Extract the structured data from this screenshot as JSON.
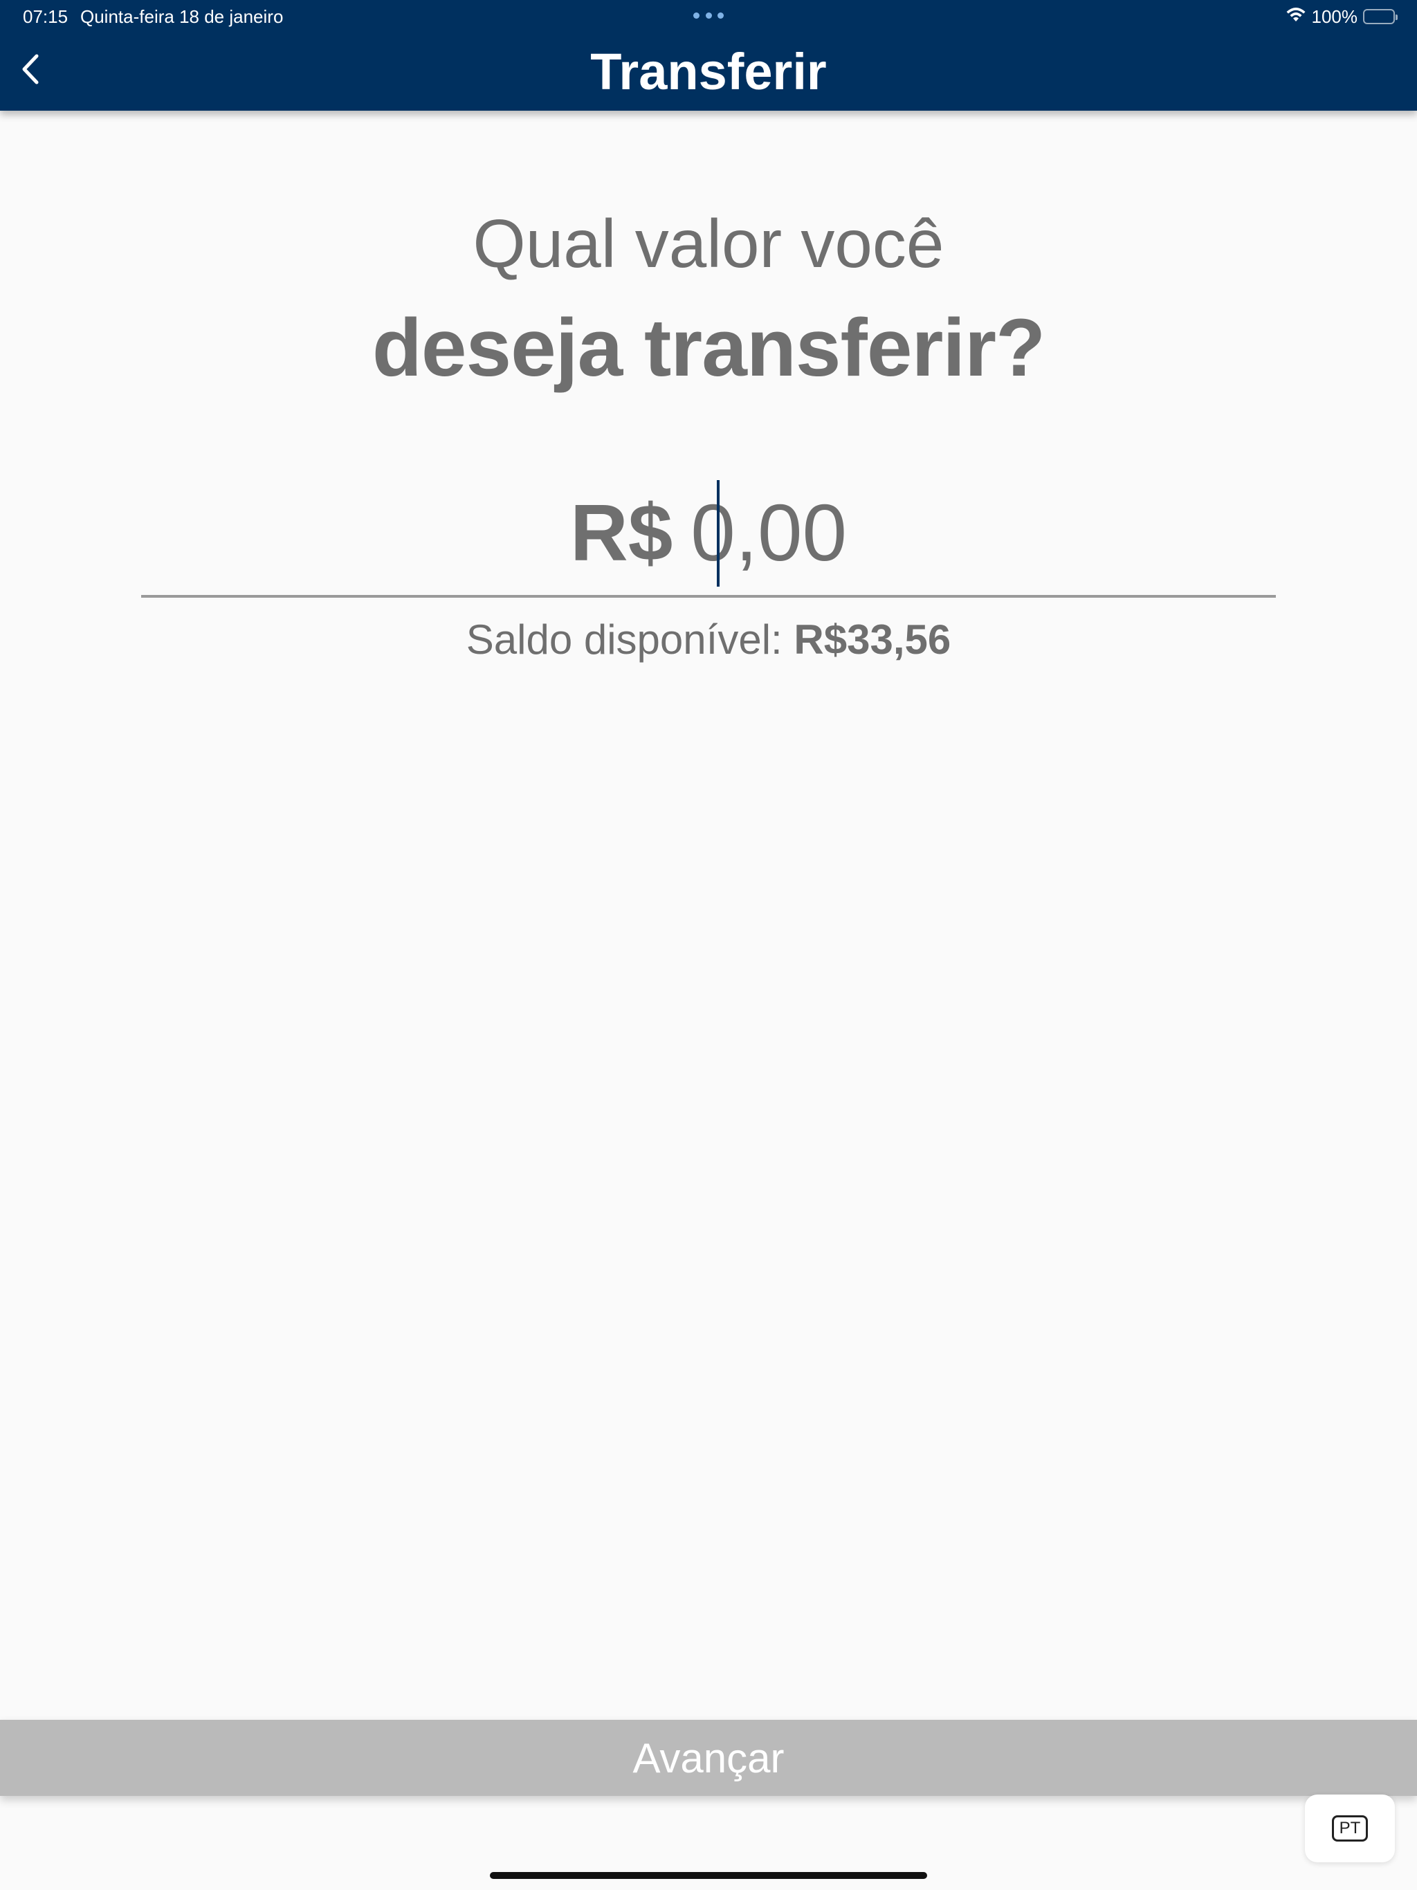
{
  "status_bar": {
    "time": "07:15",
    "date": "Quinta-feira 18 de janeiro",
    "battery": "100%",
    "wifi_icon": "wifi-icon",
    "battery_icon": "battery-icon"
  },
  "header": {
    "title": "Transferir",
    "back_icon": "chevron-left-icon"
  },
  "prompt": {
    "line1": "Qual valor você",
    "line2": "deseja transferir?"
  },
  "amount": {
    "currency": "R$",
    "value": "0,00"
  },
  "balance": {
    "label": "Saldo disponível: ",
    "value": "R$33,56"
  },
  "footer": {
    "advance_label": "Avançar"
  },
  "keyboard": {
    "language": "PT"
  },
  "colors": {
    "header_bg": "#00305f",
    "text_gray": "#6f6f6f",
    "button_disabled": "#bababa"
  }
}
